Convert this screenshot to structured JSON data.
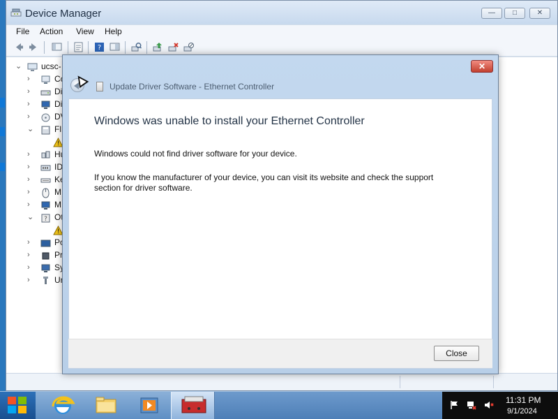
{
  "device_manager": {
    "title": "Device Manager",
    "menu": [
      "File",
      "Action",
      "View",
      "Help"
    ],
    "tree": {
      "root_label": "ucsc-",
      "items": [
        "Co",
        "Di",
        "Di",
        "DV",
        "Fl",
        "",
        "Hu",
        "ID",
        "Ke",
        "M",
        "M",
        "Ot",
        "",
        "Po",
        "Pr",
        "Sy",
        "Ur"
      ]
    }
  },
  "dialog": {
    "title": "Update Driver Software - Ethernet Controller",
    "heading": "Windows was unable to install your Ethernet Controller",
    "line1": "Windows could not find driver software for your device.",
    "line2": "If you know the manufacturer of your device, you can visit its website and check the support section for driver software.",
    "close_button": "Close"
  },
  "taskbar": {
    "time": "11:31 PM",
    "date": "9/1/2024"
  },
  "colors": {
    "dialog_close_red": "#c2402f",
    "taskbar_blue": "#5e8fc4",
    "windows_red": "#f35325",
    "windows_green": "#81bc06",
    "windows_blue": "#05a6f0",
    "windows_yellow": "#ffba08"
  },
  "icons": {
    "title": "device-manager-icon",
    "back": "back-arrow-icon",
    "device": "ethernet-device-icon",
    "ie": "internet-explorer-icon",
    "explorer": "file-explorer-icon",
    "media": "media-player-icon",
    "device_manager_task": "device-manager-taskbar-icon",
    "tray_flag": "action-center-flag-icon",
    "tray_network": "network-icon",
    "tray_volume": "volume-muted-icon"
  }
}
